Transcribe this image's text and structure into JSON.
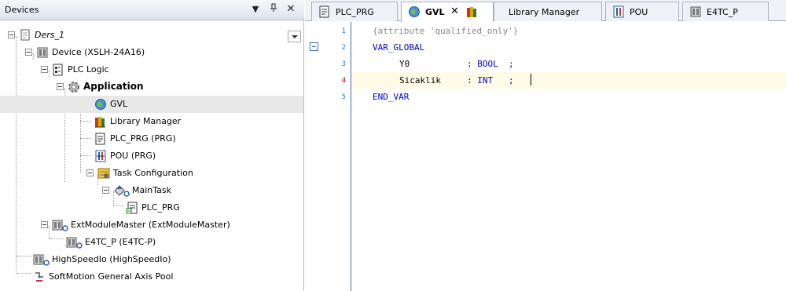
{
  "devices_panel": {
    "title": "Devices",
    "pin_icon": "pin-icon",
    "dropdown_icon": "chevron-down-icon",
    "close_icon": "close-icon",
    "tree": [
      {
        "label": "Ders_1",
        "icon": "project-icon"
      },
      {
        "label": "Device (XSLH-24A16)",
        "icon": "device-icon"
      },
      {
        "label": "PLC Logic",
        "icon": "plc-logic-icon"
      },
      {
        "label": "Application",
        "icon": "application-gear-icon"
      },
      {
        "label": "GVL",
        "icon": "globe-icon"
      },
      {
        "label": "Library Manager",
        "icon": "books-icon"
      },
      {
        "label": "PLC_PRG (PRG)",
        "icon": "program-icon"
      },
      {
        "label": "POU (PRG)",
        "icon": "pou-icon"
      },
      {
        "label": "Task Configuration",
        "icon": "task-config-icon"
      },
      {
        "label": "MainTask",
        "icon": "task-icon"
      },
      {
        "label": "PLC_PRG",
        "icon": "program-call-icon"
      },
      {
        "label": "ExtModuleMaster (ExtModuleMaster)",
        "icon": "module-icon"
      },
      {
        "label": "E4TC_P (E4TC-P)",
        "icon": "module-icon"
      },
      {
        "label": "HighSpeedIo (HighSpeedIo)",
        "icon": "module-icon"
      },
      {
        "label": "SoftMotion General Axis Pool",
        "icon": "axis-pool-icon"
      }
    ]
  },
  "editor": {
    "tabs": [
      {
        "label": "PLC_PRG",
        "icon": "program-icon",
        "active": false
      },
      {
        "label": "GVL",
        "icon": "globe-icon",
        "active": true,
        "close": "x"
      },
      {
        "label": "Library Manager",
        "icon": "books-icon",
        "active": false
      },
      {
        "label": "POU",
        "icon": "pou-icon",
        "active": false
      },
      {
        "label": "E4TC_P",
        "icon": "module-icon",
        "active": false
      }
    ],
    "line_numbers": [
      "1",
      "2",
      "3",
      "4",
      "5"
    ],
    "code": {
      "l1": "{attribute 'qualified_only'}",
      "l2": "VAR_GLOBAL",
      "l3_name": "Y0",
      "l3_type": ": BOOL  ;",
      "l4_name": "Sicaklik",
      "l4_type": ": INT   ;",
      "l5": "END_VAR"
    }
  },
  "colors": {
    "keyword": "#0000cc",
    "comment": "#888888",
    "line_number": "#2b78c5",
    "modified_line_number": "#c00000",
    "current_line_bg": "#fffbe6",
    "selected_row_bg": "#e8e8e8"
  }
}
